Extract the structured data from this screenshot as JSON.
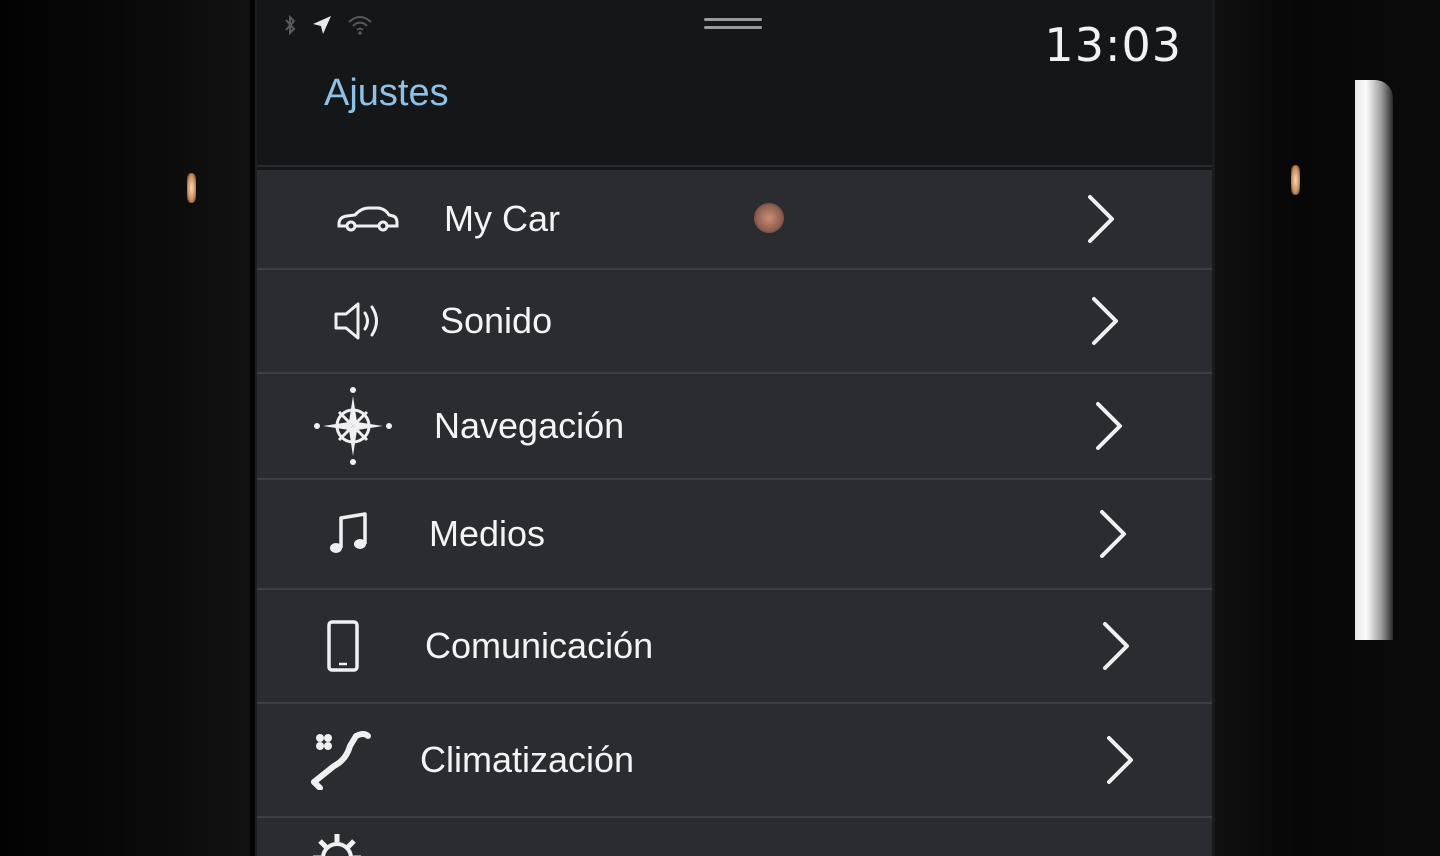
{
  "status_bar": {
    "icons": [
      "bluetooth-icon",
      "navigation-arrow-icon",
      "wifi-icon"
    ],
    "time": "13:03"
  },
  "page": {
    "title": "Ajustes",
    "accent_color": "#8fc1e6"
  },
  "menu": {
    "items": [
      {
        "label": "My Car",
        "icon": "car-icon"
      },
      {
        "label": "Sonido",
        "icon": "speaker-icon"
      },
      {
        "label": "Navegación",
        "icon": "compass-icon"
      },
      {
        "label": "Medios",
        "icon": "music-note-icon"
      },
      {
        "label": "Comunicación",
        "icon": "phone-icon"
      },
      {
        "label": "Climatización",
        "icon": "climate-seat-icon"
      },
      {
        "label": "",
        "icon": "gear-icon"
      }
    ]
  }
}
